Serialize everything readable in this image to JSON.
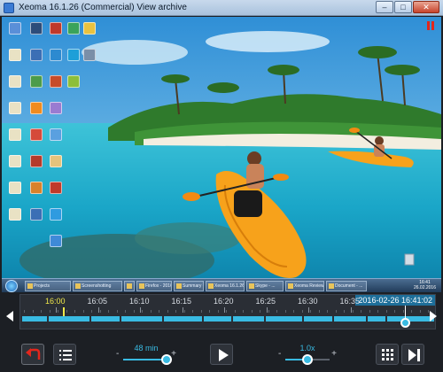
{
  "window": {
    "title": "Xeoma 16.1.26 (Commercial) View archive",
    "minimize_glyph": "–",
    "maximize_glyph": "□",
    "close_glyph": "✕",
    "app_icon": "xeoma-camera-icon"
  },
  "viewport": {
    "recording_state_icon": "pause-icon",
    "desktop_icon_count": 30,
    "captured_taskbar": {
      "tasks": [
        "Projects",
        "Screenshotting",
        "",
        "Firefox - 2016...",
        "Summary - Xeo...",
        "Xeoma 16.1.26 ...",
        "Skype - ...",
        "Xeoma Review",
        "Document - ..."
      ],
      "clock_time": "16:41",
      "clock_date": "26.02.2016"
    }
  },
  "timeline": {
    "labels": [
      "16:00",
      "16:05",
      "16:10",
      "16:15",
      "16:20",
      "16:25",
      "16:30",
      "16:35"
    ],
    "active_label_index": 0,
    "current_datetime": "2016-02-26 16:41:02",
    "prev_icon": "triangle-left-icon",
    "next_icon": "triangle-right-icon",
    "playhead_fraction": 0.93
  },
  "controls": {
    "back_icon": "return-arrow-icon",
    "list_icon": "list-icon",
    "duration_value": "48 min",
    "duration_fraction": 0.95,
    "play_icon": "play-icon",
    "speed_value": "1.0x",
    "speed_fraction": 0.5,
    "grid_icon": "grid-icon",
    "skip_icon": "skip-to-end-icon",
    "minus_glyph": "-",
    "plus_glyph": "+"
  },
  "colors": {
    "accent": "#39bbe3",
    "active_label": "#f0e84a",
    "pause_red": "#e2261c"
  }
}
